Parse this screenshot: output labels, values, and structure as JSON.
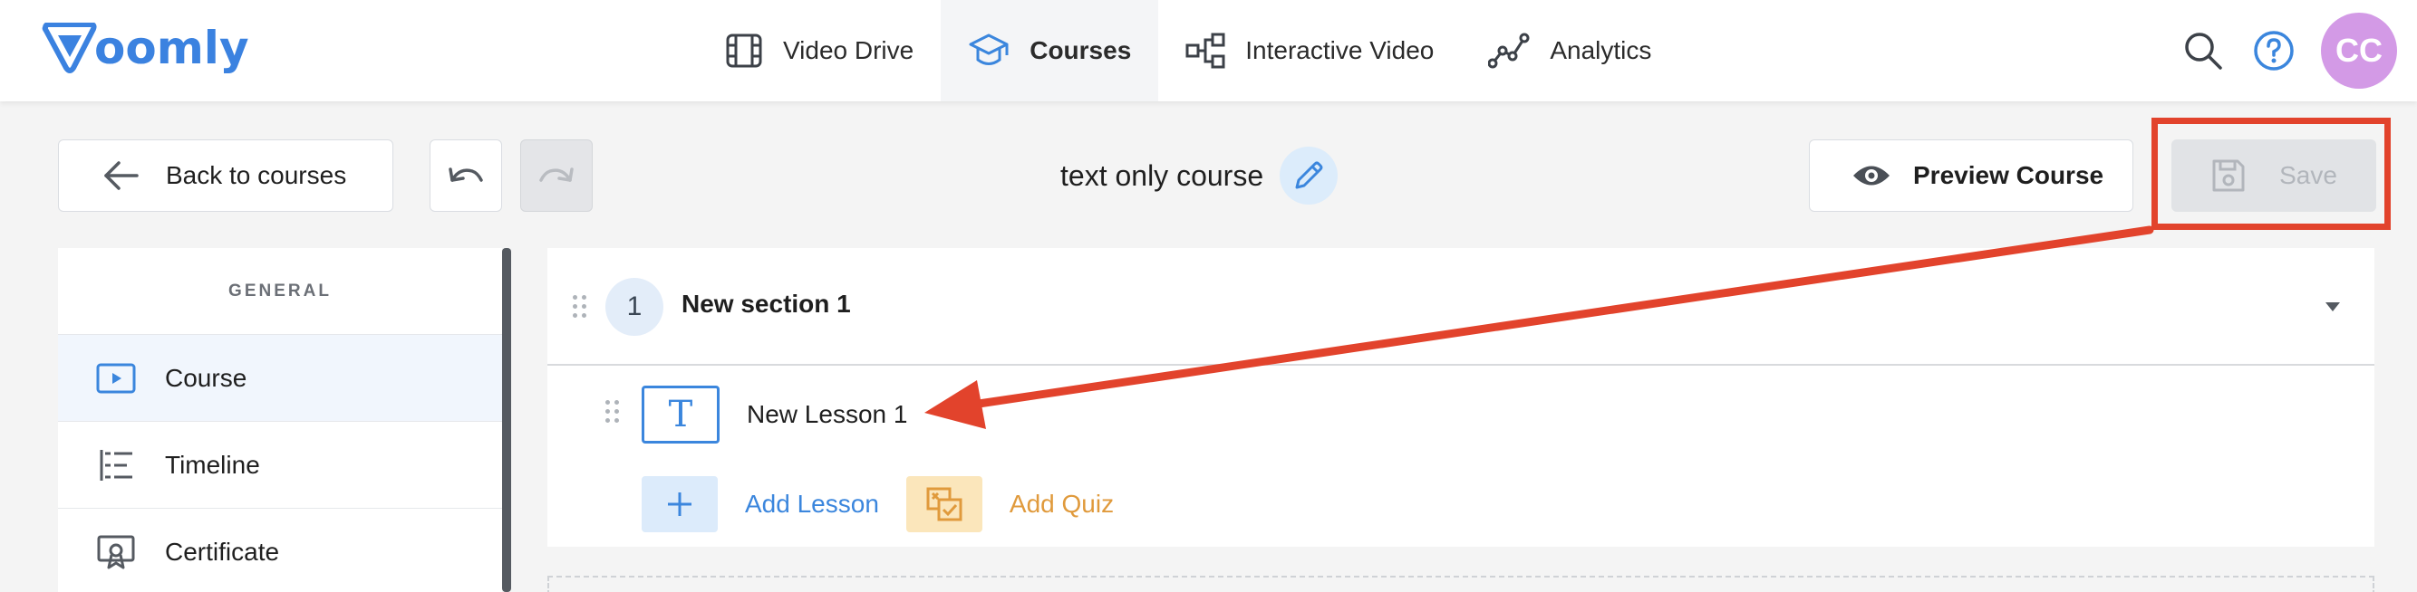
{
  "app": {
    "logo_text": "oomly",
    "accent": "#3b82e0"
  },
  "nav": {
    "items": [
      {
        "label": "Video Drive",
        "icon": "film-icon",
        "active": false
      },
      {
        "label": "Courses",
        "icon": "graduation-cap-icon",
        "active": true
      },
      {
        "label": "Interactive Video",
        "icon": "flowchart-icon",
        "active": false
      },
      {
        "label": "Analytics",
        "icon": "line-chart-icon",
        "active": false
      }
    ],
    "avatar_initials": "CC"
  },
  "toolbar": {
    "back_label": "Back to courses",
    "course_title": "text only course",
    "preview_label": "Preview Course",
    "save_label": "Save"
  },
  "sidebar": {
    "header": "GENERAL",
    "items": [
      {
        "label": "Course",
        "icon": "video-icon",
        "active": true
      },
      {
        "label": "Timeline",
        "icon": "timeline-icon",
        "active": false
      },
      {
        "label": "Certificate",
        "icon": "certificate-icon",
        "active": false
      }
    ]
  },
  "section": {
    "number": "1",
    "title": "New section 1",
    "lesson": {
      "title": "New Lesson 1",
      "icon_letter": "T"
    },
    "add_lesson_label": "Add Lesson",
    "add_quiz_label": "Add Quiz"
  },
  "annotation": {
    "color": "#e2432c"
  }
}
